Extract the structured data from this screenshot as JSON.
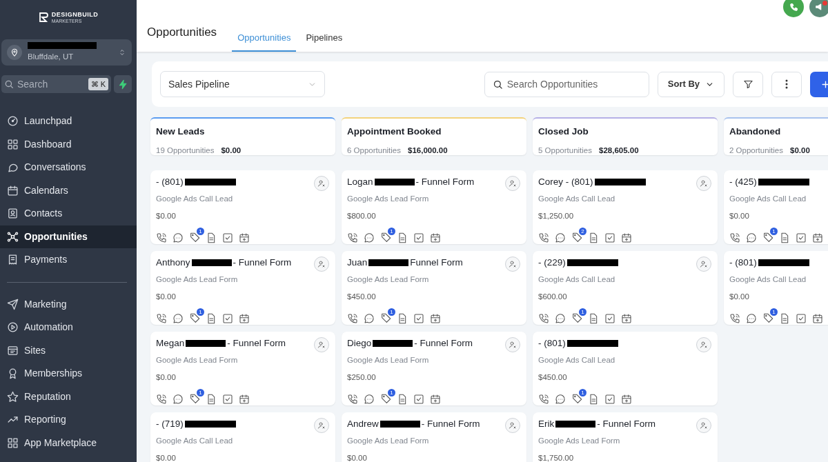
{
  "sidebar": {
    "logo": {
      "name": "DESIGNBUILD",
      "tagline": "MARKETERS"
    },
    "location": {
      "city": "Bluffdale, UT"
    },
    "search": {
      "placeholder": "Search",
      "shortcut": "⌘ K"
    },
    "groups": [
      [
        {
          "label": "Launchpad",
          "selected": false
        },
        {
          "label": "Dashboard",
          "selected": false
        },
        {
          "label": "Conversations",
          "selected": false
        },
        {
          "label": "Calendars",
          "selected": false
        },
        {
          "label": "Contacts",
          "selected": false
        },
        {
          "label": "Opportunities",
          "selected": true
        },
        {
          "label": "Payments",
          "selected": false
        }
      ],
      [
        {
          "label": "Marketing",
          "selected": false
        },
        {
          "label": "Automation",
          "selected": false
        },
        {
          "label": "Sites",
          "selected": false
        },
        {
          "label": "Memberships",
          "selected": false
        },
        {
          "label": "Reputation",
          "selected": false
        },
        {
          "label": "Reporting",
          "selected": false
        },
        {
          "label": "App Marketplace",
          "selected": false
        }
      ]
    ]
  },
  "header": {
    "title": "Opportunities",
    "tabs": [
      {
        "label": "Opportunities",
        "selected": true
      },
      {
        "label": "Pipelines",
        "selected": false
      }
    ]
  },
  "toolbar": {
    "pipeline": "Sales Pipeline",
    "search_placeholder": "Search Opportunities",
    "sort_label": "Sort By"
  },
  "columns": [
    {
      "name": "New Leads",
      "count": "19 Opportunities",
      "total": "$0.00",
      "color": "#5b9cf0",
      "cards": [
        {
          "name": "- (801)",
          "source": "Google Ads Call Lead",
          "value": "$0.00",
          "tags": "1",
          "assign": true
        },
        {
          "name": "Anthony",
          "suffix": "- Funnel Form",
          "source": "Google Ads Lead Form",
          "value": "$0.00",
          "tags": "1",
          "assign": true
        },
        {
          "name": "Megan",
          "suffix": "- Funnel Form",
          "source": "Google Ads Lead Form",
          "value": "$0.00",
          "tags": "1",
          "assign": true
        },
        {
          "name": "- (719)",
          "source": "Google Ads Call Lead",
          "value": "$0.00",
          "assign": true
        }
      ]
    },
    {
      "name": "Appointment Booked",
      "count": "6 Opportunities",
      "total": "$16,000.00",
      "color": "#f3d37c",
      "cards": [
        {
          "name": "Logan",
          "suffix": "- Funnel Form",
          "source": "Google Ads Lead Form",
          "value": "$800.00",
          "tags": "1",
          "assign": true
        },
        {
          "name": "Juan",
          "suffix": "Funnel Form",
          "source": "Google Ads Lead Form",
          "value": "$450.00",
          "tags": "1",
          "assign": true
        },
        {
          "name": "Diego",
          "suffix": "- Funnel Form",
          "source": "Google Ads Lead Form",
          "value": "$250.00",
          "tags": "1",
          "assign": true
        },
        {
          "name": "Andrew",
          "suffix": "- Funnel Form",
          "source": "Google Ads Lead Form",
          "value": "$0.00",
          "assign": true
        }
      ]
    },
    {
      "name": "Closed Job",
      "count": "5 Opportunities",
      "total": "$28,605.00",
      "color": "#b5b0e6",
      "cards": [
        {
          "name": "Corey - (801)",
          "source": "Google Ads Call Lead",
          "value": "$1,250.00",
          "tags": "2",
          "assign": true
        },
        {
          "name": "- (229)",
          "source": "Google Ads Call Lead",
          "value": "$600.00",
          "tags": "1",
          "assign": true
        },
        {
          "name": "- (801)",
          "source": "Google Ads Call Lead",
          "value": "$450.00",
          "tags": "1",
          "assign": true
        },
        {
          "name": "Erik",
          "suffix": "- Funnel Form",
          "source": "Google Ads Lead Form",
          "value": "$1,750.00",
          "assign": true
        }
      ]
    },
    {
      "name": "Abandoned",
      "count": "2 Opportunities",
      "total": "$0.00",
      "color": "#a8c2ee",
      "cards": [
        {
          "name": "- (425)",
          "source": "Google Ads Call Lead",
          "value": "$0.00",
          "tags": "1",
          "assign": false
        },
        {
          "name": "- (801)",
          "source": "Google Ads Call Lead",
          "value": "$0.00",
          "tags": "1",
          "assign": false
        }
      ]
    }
  ]
}
